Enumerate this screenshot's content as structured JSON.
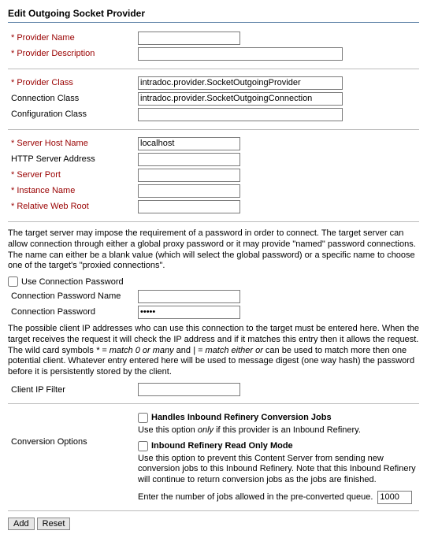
{
  "title": "Edit Outgoing Socket Provider",
  "labels": {
    "providerName": "* Provider Name",
    "providerDescription": "* Provider Description",
    "providerClass": "* Provider Class",
    "connectionClass": "Connection Class",
    "configurationClass": "Configuration Class",
    "serverHostName": "* Server Host Name",
    "httpServerAddress": "HTTP Server Address",
    "serverPort": "* Server Port",
    "instanceName": "* Instance Name",
    "relativeWebRoot": "* Relative Web Root",
    "useConnectionPassword": "Use Connection Password",
    "connectionPasswordName": "Connection Password Name",
    "connectionPassword": "Connection Password",
    "clientIpFilter": "Client IP Filter",
    "conversionOptions": "Conversion Options"
  },
  "values": {
    "providerName": "",
    "providerDescription": "",
    "providerClass": "intradoc.provider.SocketOutgoingProvider",
    "connectionClass": "intradoc.provider.SocketOutgoingConnection",
    "configurationClass": "",
    "serverHostName": "localhost",
    "httpServerAddress": "",
    "serverPort": "",
    "instanceName": "",
    "relativeWebRoot": "",
    "connectionPasswordName": "",
    "connectionPassword": "•••••",
    "clientIpFilter": "",
    "queueJobs": "1000"
  },
  "text": {
    "passwordHelp": "The target server may impose the requirement of a password in order to connect. The target server can allow connection through either a global proxy password or it may provide \"named\" password connections. The name can either be a blank value (which will select the global password) or a specific name to choose one of the target's \"proxied connections\".",
    "ipHelpPre": "The possible client IP addresses who can use this connection to the target must be entered here. When the target receives the request it will check the IP address and if it matches this entry then it allows the request. The wild card symbols ",
    "wild1": "* = match 0 or many",
    "and": " and ",
    "wild2": "| = match either or",
    "ipHelpPost": " can be used to match more then one potential client. Whatever entry entered here will be used to message digest (one way hash) the password before it is persistently stored by the client.",
    "handlesInbound": "Handles Inbound Refinery Conversion Jobs",
    "handlesInboundDesc": "Use this option only if this provider is an Inbound Refinery.",
    "only": "only",
    "readOnly": "Inbound Refinery Read Only Mode",
    "readOnlyDesc": "Use this option to prevent this Content Server from sending new conversion jobs to this Inbound Refinery. Note that this Inbound Refinery will continue to return conversion jobs as the jobs are finished.",
    "queueLabel": "Enter the number of jobs allowed in the pre-converted queue."
  },
  "buttons": {
    "add": "Add",
    "reset": "Reset"
  }
}
